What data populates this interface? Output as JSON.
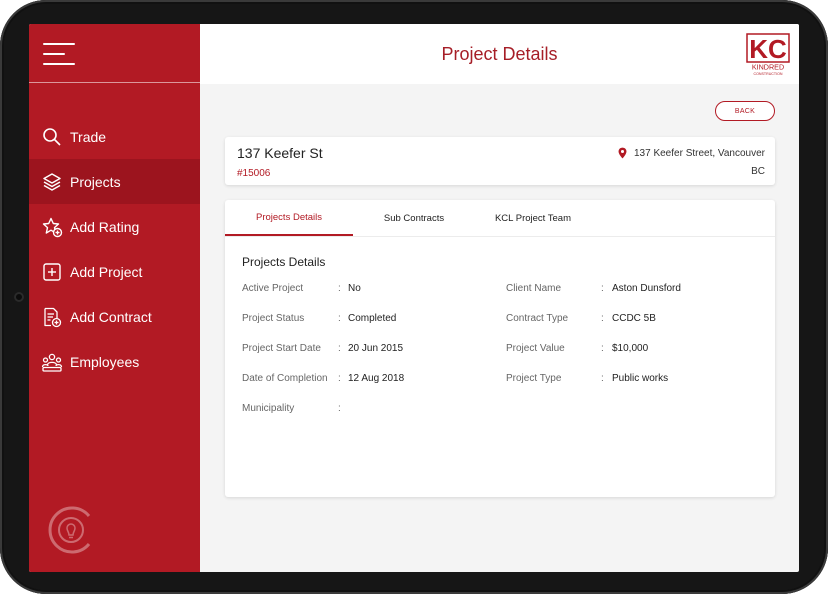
{
  "sidebar": {
    "items": [
      {
        "label": "Trade",
        "icon": "search-icon"
      },
      {
        "label": "Projects",
        "icon": "layers-icon",
        "active": true
      },
      {
        "label": "Add Rating",
        "icon": "star-badge-icon"
      },
      {
        "label": "Add Project",
        "icon": "add-square-icon"
      },
      {
        "label": "Add Contract",
        "icon": "contract-add-icon"
      },
      {
        "label": "Employees",
        "icon": "people-icon"
      }
    ]
  },
  "header": {
    "title": "Project Details",
    "brand_name": "KINDRED",
    "brand_sub": "CONSTRUCTION",
    "brand_monogram": "KC"
  },
  "back_label": "BACK",
  "project": {
    "name": "137 Keefer St",
    "number": "#15006",
    "address_line1": "137 Keefer Street, Vancouver",
    "address_line2": "BC"
  },
  "tabs": [
    {
      "label": "Projects Details",
      "active": true
    },
    {
      "label": "Sub Contracts"
    },
    {
      "label": "KCL Project Team"
    }
  ],
  "details": {
    "section_title": "Projects Details",
    "left": [
      {
        "label": "Active Project",
        "value": "No"
      },
      {
        "label": "Project Status",
        "value": "Completed"
      },
      {
        "label": "Project Start Date",
        "value": "20 Jun 2015"
      },
      {
        "label": "Date of Completion",
        "value": "12 Aug 2018"
      },
      {
        "label": "Municipality",
        "value": ""
      }
    ],
    "right": [
      {
        "label": "Client Name",
        "value": "Aston Dunsford"
      },
      {
        "label": "Contract Type",
        "value": "CCDC 5B"
      },
      {
        "label": "Project Value",
        "value": "$10,000"
      },
      {
        "label": "Project Type",
        "value": "Public works"
      }
    ]
  },
  "colors": {
    "brand_red": "#b21a24",
    "active_nav": "#9c141e",
    "title_red": "#a61e27"
  }
}
